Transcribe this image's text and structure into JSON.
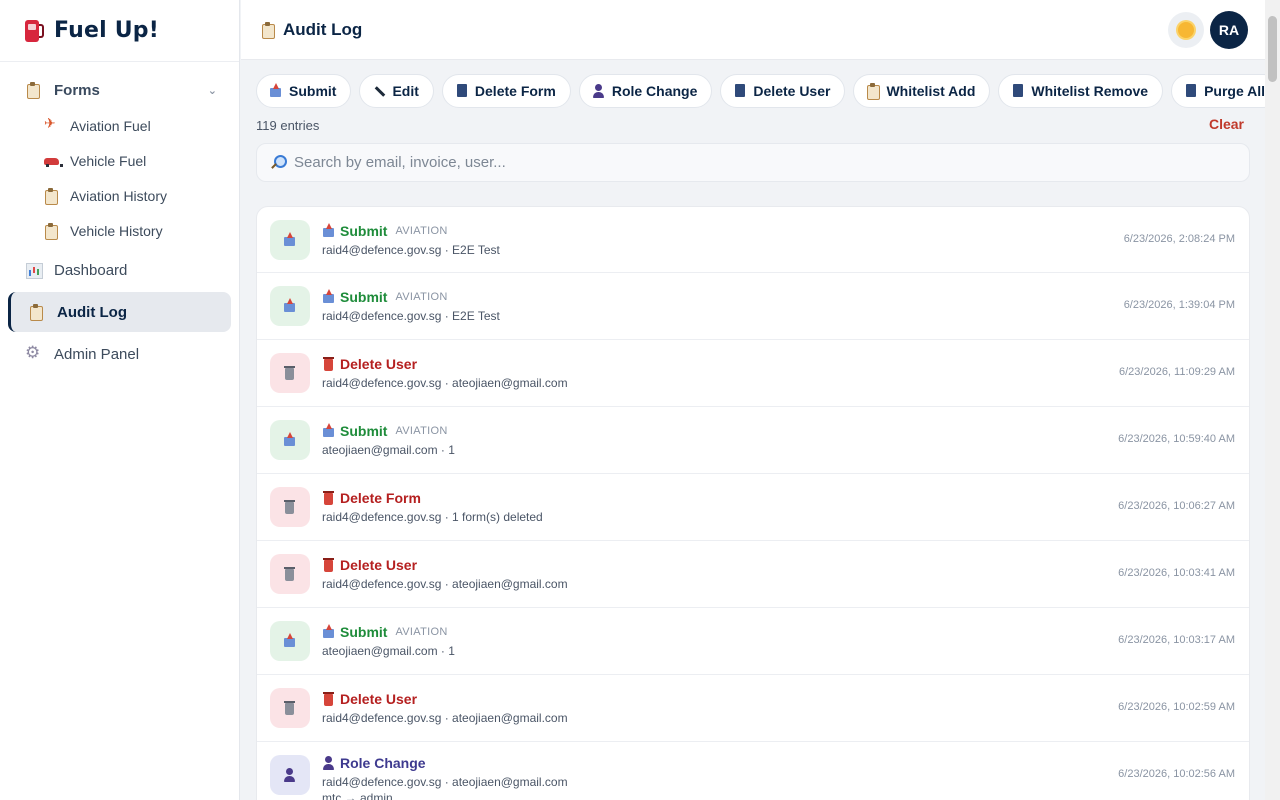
{
  "app": {
    "name": "Fuel Up!"
  },
  "sidebar": {
    "group": {
      "label": "Forms",
      "chevron": "⌄"
    },
    "sub_items": [
      {
        "label": "Aviation Fuel",
        "icon": "helicopter-icon"
      },
      {
        "label": "Vehicle Fuel",
        "icon": "car-icon"
      },
      {
        "label": "Aviation History",
        "icon": "clipboard-icon"
      },
      {
        "label": "Vehicle History",
        "icon": "clipboard-icon"
      }
    ],
    "items": [
      {
        "label": "Dashboard",
        "icon": "bar-chart-icon"
      },
      {
        "label": "Audit Log",
        "icon": "clipboard-icon",
        "active": true
      },
      {
        "label": "Admin Panel",
        "icon": "gear-icon"
      }
    ]
  },
  "header": {
    "title": "Audit Log",
    "avatar_initials": "RA",
    "theme_icon": "sun-icon"
  },
  "filters": [
    {
      "label": "Submit",
      "icon": "outbox-icon"
    },
    {
      "label": "Edit",
      "icon": "pencil-icon"
    },
    {
      "label": "Delete Form",
      "icon": "trash-icon"
    },
    {
      "label": "Role Change",
      "icon": "user-icon"
    },
    {
      "label": "Delete User",
      "icon": "trash-icon"
    },
    {
      "label": "Whitelist Add",
      "icon": "clipboard-icon"
    },
    {
      "label": "Whitelist Remove",
      "icon": "trash-icon"
    },
    {
      "label": "Purge All",
      "icon": "trash-icon"
    }
  ],
  "entries_text": "119 entries",
  "clear_label": "Clear",
  "search": {
    "placeholder": "Search by email, invoice, user...",
    "value": ""
  },
  "log": [
    {
      "type": "submit",
      "action": "Submit",
      "tag": "AVIATION",
      "detail": "raid4@defence.gov.sg · E2E Test",
      "time": "6/23/2026, 2:08:24 PM"
    },
    {
      "type": "submit",
      "action": "Submit",
      "tag": "AVIATION",
      "detail": "raid4@defence.gov.sg · E2E Test",
      "time": "6/23/2026, 1:39:04 PM"
    },
    {
      "type": "delete",
      "action": "Delete User",
      "tag": "",
      "detail": "raid4@defence.gov.sg · ateojiaen@gmail.com",
      "time": "6/23/2026, 11:09:29 AM"
    },
    {
      "type": "submit",
      "action": "Submit",
      "tag": "AVIATION",
      "detail": "ateojiaen@gmail.com · 1",
      "time": "6/23/2026, 10:59:40 AM"
    },
    {
      "type": "delete",
      "action": "Delete Form",
      "tag": "",
      "detail": "raid4@defence.gov.sg · 1 form(s) deleted",
      "time": "6/23/2026, 10:06:27 AM"
    },
    {
      "type": "delete",
      "action": "Delete User",
      "tag": "",
      "detail": "raid4@defence.gov.sg · ateojiaen@gmail.com",
      "time": "6/23/2026, 10:03:41 AM"
    },
    {
      "type": "submit",
      "action": "Submit",
      "tag": "AVIATION",
      "detail": "ateojiaen@gmail.com · 1",
      "time": "6/23/2026, 10:03:17 AM"
    },
    {
      "type": "delete",
      "action": "Delete User",
      "tag": "",
      "detail": "raid4@defence.gov.sg · ateojiaen@gmail.com",
      "time": "6/23/2026, 10:02:59 AM"
    },
    {
      "type": "role",
      "action": "Role Change",
      "tag": "",
      "detail": "raid4@defence.gov.sg · ateojiaen@gmail.com",
      "detail2": "mtc → admin",
      "time": "6/23/2026, 10:02:56 AM"
    }
  ],
  "colors": {
    "primary": "#0b2545",
    "submit": "#1e8c3a",
    "delete": "#b52020",
    "role": "#3e3a8f",
    "clear": "#c0392b"
  }
}
